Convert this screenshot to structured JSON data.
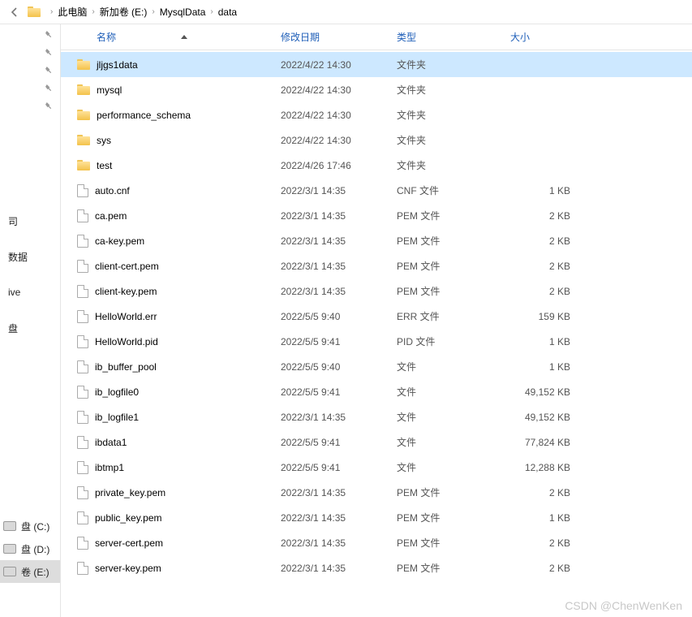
{
  "breadcrumb": {
    "items": [
      "此电脑",
      "新加卷 (E:)",
      "MysqlData",
      "data"
    ]
  },
  "columns": {
    "name": "名称",
    "date": "修改日期",
    "type": "类型",
    "size": "大小"
  },
  "sidebar": {
    "items": [
      {
        "label": "司",
        "kind": "text"
      },
      {
        "label": "数据",
        "kind": "text"
      },
      {
        "label": "ive",
        "kind": "text"
      },
      {
        "label": "盘",
        "kind": "text"
      },
      {
        "label": "",
        "kind": "spacer"
      },
      {
        "label": "盘 (C:)",
        "kind": "drive"
      },
      {
        "label": "盘 (D:)",
        "kind": "drive"
      },
      {
        "label": "卷 (E:)",
        "kind": "drive",
        "selected": true
      }
    ]
  },
  "files": [
    {
      "name": "jljgs1data",
      "date": "2022/4/22 14:30",
      "type": "文件夹",
      "size": "",
      "icon": "folder",
      "selected": true
    },
    {
      "name": "mysql",
      "date": "2022/4/22 14:30",
      "type": "文件夹",
      "size": "",
      "icon": "folder"
    },
    {
      "name": "performance_schema",
      "date": "2022/4/22 14:30",
      "type": "文件夹",
      "size": "",
      "icon": "folder"
    },
    {
      "name": "sys",
      "date": "2022/4/22 14:30",
      "type": "文件夹",
      "size": "",
      "icon": "folder"
    },
    {
      "name": "test",
      "date": "2022/4/26 17:46",
      "type": "文件夹",
      "size": "",
      "icon": "folder"
    },
    {
      "name": "auto.cnf",
      "date": "2022/3/1 14:35",
      "type": "CNF 文件",
      "size": "1 KB",
      "icon": "file"
    },
    {
      "name": "ca.pem",
      "date": "2022/3/1 14:35",
      "type": "PEM 文件",
      "size": "2 KB",
      "icon": "file"
    },
    {
      "name": "ca-key.pem",
      "date": "2022/3/1 14:35",
      "type": "PEM 文件",
      "size": "2 KB",
      "icon": "file"
    },
    {
      "name": "client-cert.pem",
      "date": "2022/3/1 14:35",
      "type": "PEM 文件",
      "size": "2 KB",
      "icon": "file"
    },
    {
      "name": "client-key.pem",
      "date": "2022/3/1 14:35",
      "type": "PEM 文件",
      "size": "2 KB",
      "icon": "file"
    },
    {
      "name": "HelloWorld.err",
      "date": "2022/5/5 9:40",
      "type": "ERR 文件",
      "size": "159 KB",
      "icon": "file"
    },
    {
      "name": "HelloWorld.pid",
      "date": "2022/5/5 9:41",
      "type": "PID 文件",
      "size": "1 KB",
      "icon": "file"
    },
    {
      "name": "ib_buffer_pool",
      "date": "2022/5/5 9:40",
      "type": "文件",
      "size": "1 KB",
      "icon": "file"
    },
    {
      "name": "ib_logfile0",
      "date": "2022/5/5 9:41",
      "type": "文件",
      "size": "49,152 KB",
      "icon": "file"
    },
    {
      "name": "ib_logfile1",
      "date": "2022/3/1 14:35",
      "type": "文件",
      "size": "49,152 KB",
      "icon": "file"
    },
    {
      "name": "ibdata1",
      "date": "2022/5/5 9:41",
      "type": "文件",
      "size": "77,824 KB",
      "icon": "file"
    },
    {
      "name": "ibtmp1",
      "date": "2022/5/5 9:41",
      "type": "文件",
      "size": "12,288 KB",
      "icon": "file"
    },
    {
      "name": "private_key.pem",
      "date": "2022/3/1 14:35",
      "type": "PEM 文件",
      "size": "2 KB",
      "icon": "file"
    },
    {
      "name": "public_key.pem",
      "date": "2022/3/1 14:35",
      "type": "PEM 文件",
      "size": "1 KB",
      "icon": "file"
    },
    {
      "name": "server-cert.pem",
      "date": "2022/3/1 14:35",
      "type": "PEM 文件",
      "size": "2 KB",
      "icon": "file"
    },
    {
      "name": "server-key.pem",
      "date": "2022/3/1 14:35",
      "type": "PEM 文件",
      "size": "2 KB",
      "icon": "file"
    }
  ],
  "watermark": "CSDN @ChenWenKen"
}
